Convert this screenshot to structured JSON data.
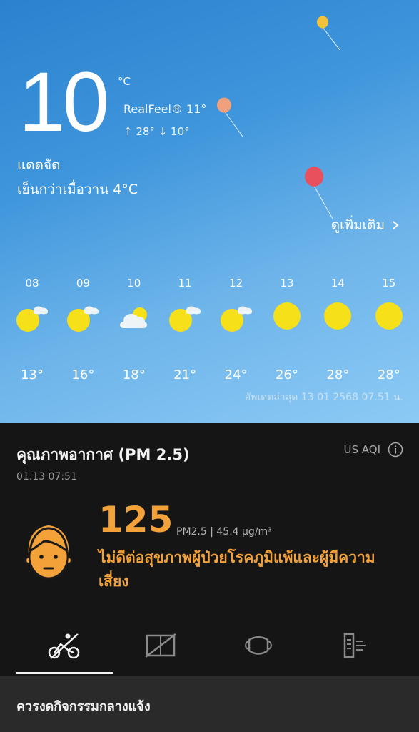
{
  "weather": {
    "temperature": "10",
    "unit": "°C",
    "realfeel": "RealFeel® 11°",
    "high_low": "↑ 28° ↓ 10°",
    "condition": "แดดจัด",
    "comparison": "เย็นกว่าเมื่อวาน 4°C",
    "more_label": "ดูเพิ่มเติม",
    "more_icon": "chevron-right-icon"
  },
  "hourly": [
    {
      "hour": "08",
      "icon": "sun-cloud-icon",
      "temp": "13°"
    },
    {
      "hour": "09",
      "icon": "sun-cloud-icon",
      "temp": "16°"
    },
    {
      "hour": "10",
      "icon": "cloud-sun-icon",
      "temp": "18°"
    },
    {
      "hour": "11",
      "icon": "sun-cloud-icon",
      "temp": "21°"
    },
    {
      "hour": "12",
      "icon": "sun-cloud-icon",
      "temp": "24°"
    },
    {
      "hour": "13",
      "icon": "sun-icon",
      "temp": "26°"
    },
    {
      "hour": "14",
      "icon": "sun-icon",
      "temp": "28°"
    },
    {
      "hour": "15",
      "icon": "sun-icon",
      "temp": "28°"
    }
  ],
  "updated": "อัพเดตล่าสุด 13 01 2568 07.51 น.",
  "air_quality": {
    "title": "คุณภาพอากาศ (PM 2.5)",
    "timestamp": "01.13 07:51",
    "standard": "US AQI",
    "value": "125",
    "pm_detail": "PM2.5 | 45.4 μg/m³",
    "description": "ไม่ดีต่อสุขภาพผู้ป่วยโรคภูมิแพ้และผู้มีความเสี่ยง",
    "accent_color": "#f3a23a"
  },
  "tabs": [
    {
      "name": "outdoor-activity",
      "icon": "cycling-icon",
      "active": true
    },
    {
      "name": "window",
      "icon": "window-closed-icon",
      "active": false
    },
    {
      "name": "mask",
      "icon": "face-mask-icon",
      "active": false
    },
    {
      "name": "air-purifier",
      "icon": "air-purifier-icon",
      "active": false
    }
  ],
  "advice": "ควรงดกิจกรรมกลางแจ้ง"
}
